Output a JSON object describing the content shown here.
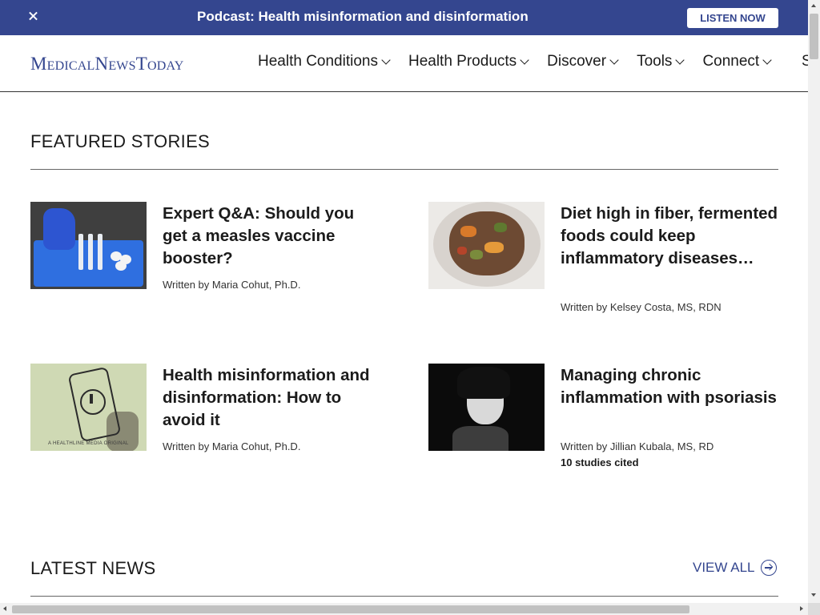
{
  "promo": {
    "title": "Podcast: Health misinformation and disinformation",
    "button": "LISTEN NOW",
    "close_icon": "close-icon",
    "background": "#34468f"
  },
  "nav": {
    "logo": "MedicalNewsToday",
    "items": [
      "Health Conditions",
      "Health Products",
      "Discover",
      "Tools",
      "Connect"
    ],
    "overflow_text": "S"
  },
  "featured": {
    "heading": "FEATURED STORIES",
    "stories": [
      {
        "title": "Expert Q&A: Should you get a measles vaccine booster?",
        "byline": "Written by Maria Cohut, Ph.D.",
        "cited": ""
      },
      {
        "title": "Diet high in fiber, fermented foods could keep inflammatory diseases…",
        "byline": "Written by Kelsey Costa, MS, RDN",
        "cited": ""
      },
      {
        "title": "Health misinformation and disinformation: How to avoid it",
        "byline": "Written by Maria Cohut, Ph.D.",
        "cited": "",
        "image_caption": "A HEALTHLINE MEDIA ORIGINAL"
      },
      {
        "title": "Managing chronic inflammation with psoriasis",
        "byline": "Written by Jillian Kubala, MS, RD",
        "cited": "10 studies cited"
      }
    ]
  },
  "latest": {
    "heading": "LATEST NEWS",
    "view_all": "VIEW ALL"
  },
  "colors": {
    "accent": "#34468f",
    "text": "#1b1b1b"
  }
}
